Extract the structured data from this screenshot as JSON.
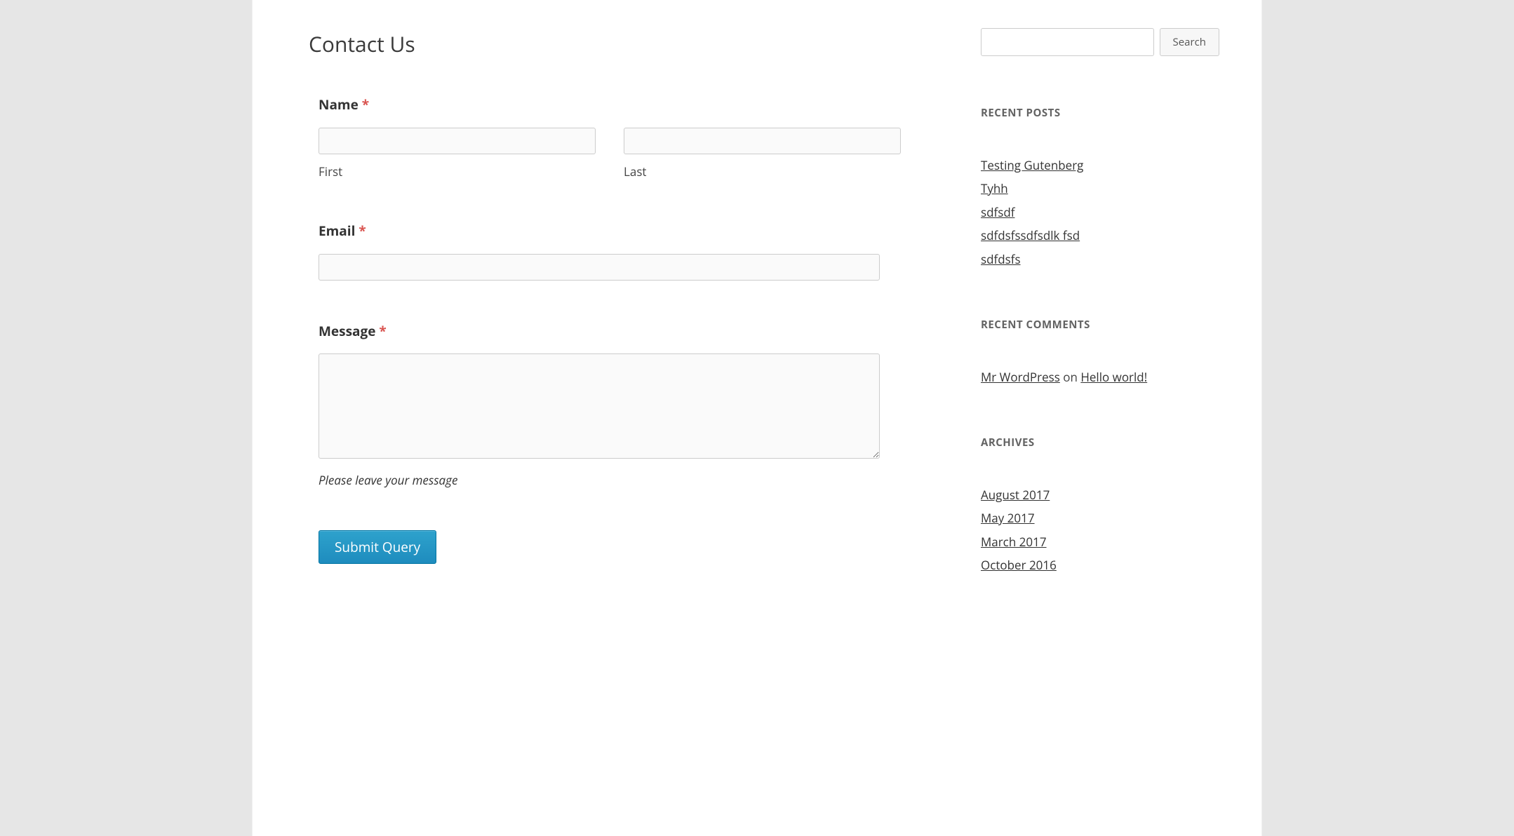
{
  "page": {
    "title": "Contact Us"
  },
  "form": {
    "name": {
      "label": "Name",
      "required": "*",
      "first_sub": "First",
      "last_sub": "Last"
    },
    "email": {
      "label": "Email",
      "required": "*"
    },
    "message": {
      "label": "Message",
      "required": "*",
      "helper": "Please leave your message"
    },
    "submit_label": "Submit Query"
  },
  "sidebar": {
    "search": {
      "button_label": "Search"
    },
    "recent_posts": {
      "title": "RECENT POSTS",
      "items": [
        "Testing Gutenberg",
        "Tyhh",
        "sdfsdf",
        "sdfdsfssdfsdlk fsd",
        "sdfdsfs"
      ]
    },
    "recent_comments": {
      "title": "RECENT COMMENTS",
      "author": "Mr WordPress",
      "on_text": " on ",
      "post": "Hello world!"
    },
    "archives": {
      "title": "ARCHIVES",
      "items": [
        "August 2017",
        "May 2017",
        "March 2017",
        "October 2016"
      ]
    }
  }
}
